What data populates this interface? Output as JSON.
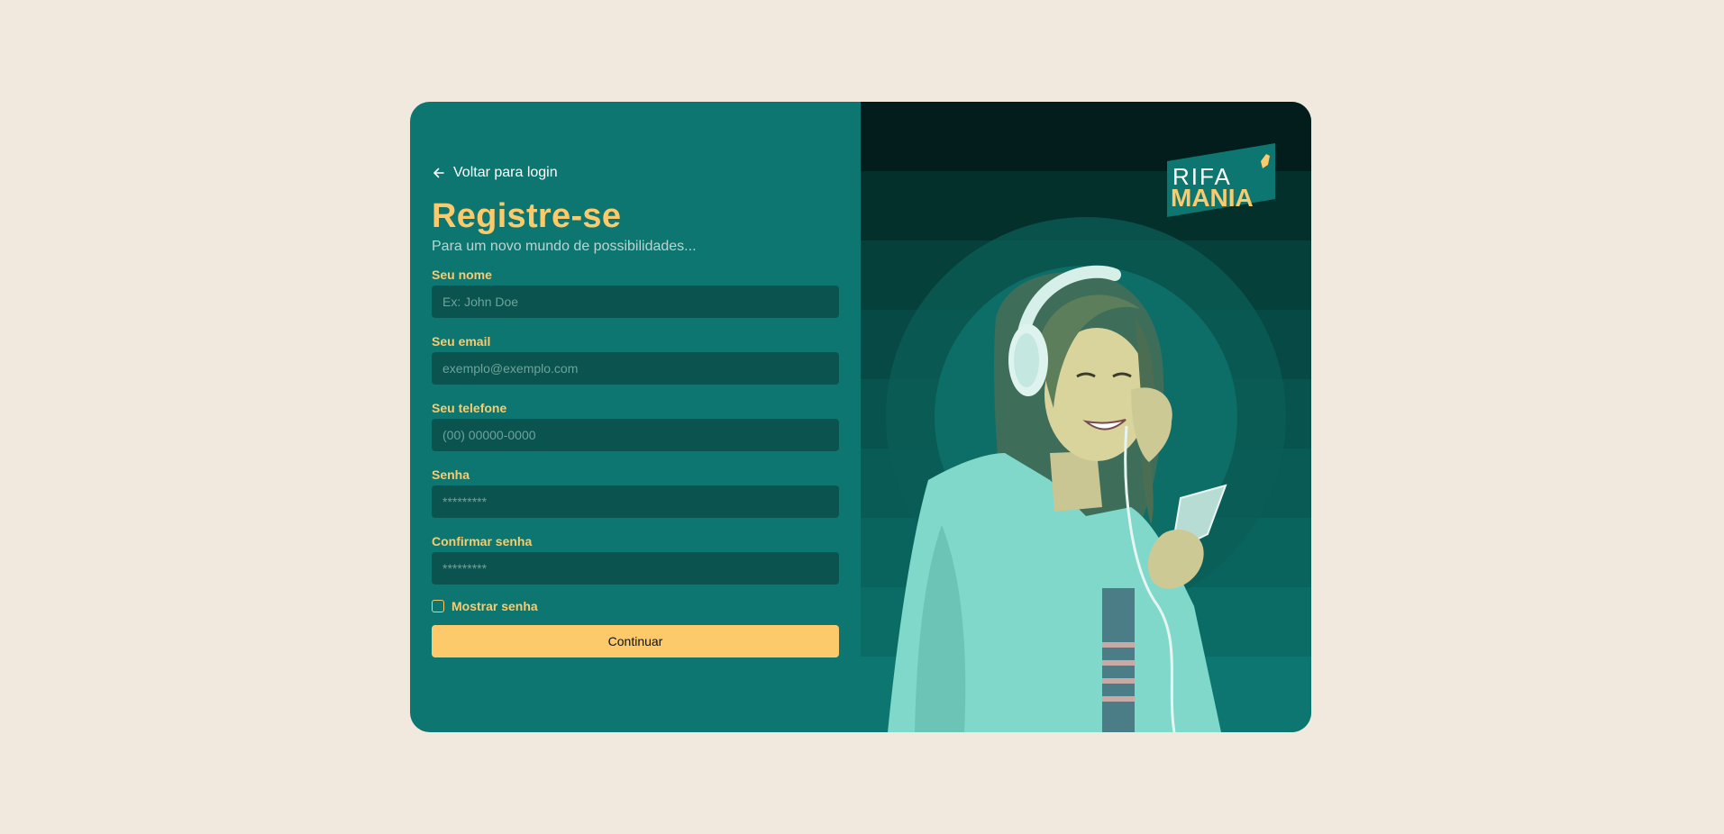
{
  "back_link": {
    "label": "Voltar para login",
    "icon": "arrow-left-icon"
  },
  "heading": {
    "title": "Registre-se",
    "subtitle": "Para um novo mundo de possibilidades..."
  },
  "form": {
    "name": {
      "label": "Seu nome",
      "placeholder": "Ex: John Doe"
    },
    "email": {
      "label": "Seu email",
      "placeholder": "exemplo@exemplo.com"
    },
    "phone": {
      "label": "Seu telefone",
      "placeholder": "(00) 00000-0000"
    },
    "password": {
      "label": "Senha",
      "placeholder": "*********"
    },
    "confirm_password": {
      "label": "Confirmar senha",
      "placeholder": "*********"
    },
    "show_password": {
      "label": "Mostrar senha",
      "checked": false
    },
    "submit_label": "Continuar"
  },
  "brand": {
    "logo_line1": "RIFA",
    "logo_line2": "MANIA"
  },
  "colors": {
    "page_bg": "#f1e9dd",
    "card_bg": "#0d7670",
    "accent": "#fdca6b",
    "input_bg": "#0a534e"
  }
}
